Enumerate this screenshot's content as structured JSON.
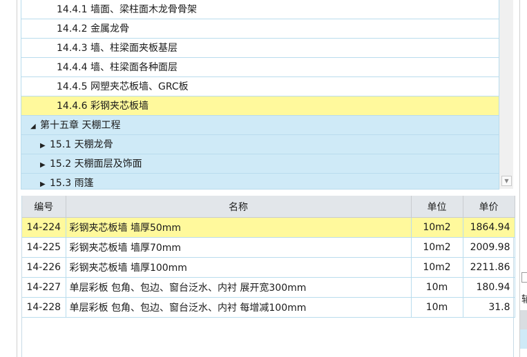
{
  "tree": {
    "items": [
      {
        "label": "14.4.1 墙面、梁柱面木龙骨骨架",
        "level": 3,
        "selected": false
      },
      {
        "label": "14.4.2 金属龙骨",
        "level": 3,
        "selected": false
      },
      {
        "label": "14.4.3 墙、柱梁面夹板基层",
        "level": 3,
        "selected": false
      },
      {
        "label": "14.4.4 墙、柱梁面各种面层",
        "level": 3,
        "selected": false
      },
      {
        "label": "14.4.5 网塑夹芯板墙、GRC板",
        "level": 3,
        "selected": false
      },
      {
        "label": "14.4.6 彩钢夹芯板墙",
        "level": 3,
        "selected": true
      },
      {
        "label": "第十五章 天棚工程",
        "level": 1,
        "expanded": true,
        "caret": "◢"
      },
      {
        "label": "15.1 天棚龙骨",
        "level": 2,
        "expanded": false,
        "caret": "▶"
      },
      {
        "label": "15.2 天棚面层及饰面",
        "level": 2,
        "expanded": false,
        "caret": "▶"
      },
      {
        "label": "15.3 雨篷",
        "level": 2,
        "expanded": false,
        "caret": "▶"
      }
    ]
  },
  "table": {
    "headers": {
      "code": "编号",
      "name": "名称",
      "unit": "单位",
      "price": "单价"
    },
    "rows": [
      {
        "code": "14-224",
        "name": "彩钢夹芯板墙 墙厚50mm",
        "unit": "10m2",
        "price": "1864.94",
        "selected": true
      },
      {
        "code": "14-225",
        "name": "彩钢夹芯板墙 墙厚70mm",
        "unit": "10m2",
        "price": "2009.98",
        "selected": false
      },
      {
        "code": "14-226",
        "name": "彩钢夹芯板墙 墙厚100mm",
        "unit": "10m2",
        "price": "2211.86",
        "selected": false
      },
      {
        "code": "14-227",
        "name": "单层彩板 包角、包边、窗台泛水、内衬 展开宽300mm",
        "unit": "10m",
        "price": "180.94",
        "selected": false
      },
      {
        "code": "14-228",
        "name": "单层彩板 包角、包边、窗台泛水、内衬 每增减100mm",
        "unit": "10m",
        "price": "31.8",
        "selected": false
      }
    ]
  },
  "right_panel": {
    "label": "辅"
  },
  "icons": {
    "scroll_down": "scroll-down-arrow-icon"
  },
  "colors": {
    "selected": "#fff99c",
    "chapter_bg": "#cfeaf7",
    "header_bg": "#e2e6ea",
    "grid": "#b9dced"
  }
}
